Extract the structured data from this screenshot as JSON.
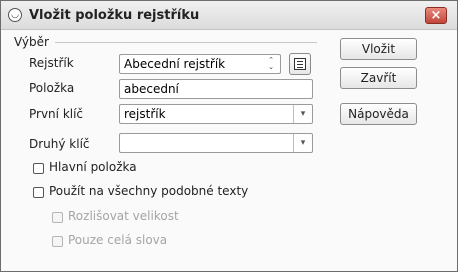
{
  "window": {
    "title": "Vložit položku rejstříku",
    "close_glyph": "×",
    "app_glyph": "◡"
  },
  "group": {
    "label": "Výběr"
  },
  "fields": {
    "rejstrik": {
      "label": "Rejstřík",
      "value": "Abecední rejstřík"
    },
    "polozka": {
      "label": "Položka",
      "value": "abecední"
    },
    "prvni_klic": {
      "label": "První klíč",
      "value": "rejstřík"
    },
    "druhy_klic": {
      "label": "Druhý klíč",
      "value": ""
    }
  },
  "checkboxes": {
    "hlavni_polozka": {
      "label": "Hlavní položka",
      "checked": false,
      "enabled": true
    },
    "pouzit_na_vsechny": {
      "label": "Použít na všechny podobné texty",
      "checked": false,
      "enabled": true
    },
    "rozlisovat_velikost": {
      "label": "Rozlišovat velikost",
      "checked": false,
      "enabled": false
    },
    "pouze_cela_slova": {
      "label": "Pouze celá slova",
      "checked": false,
      "enabled": false
    }
  },
  "buttons": {
    "vlozit": "Vložit",
    "zavrit": "Zavřít",
    "napoveda": "Nápověda"
  }
}
